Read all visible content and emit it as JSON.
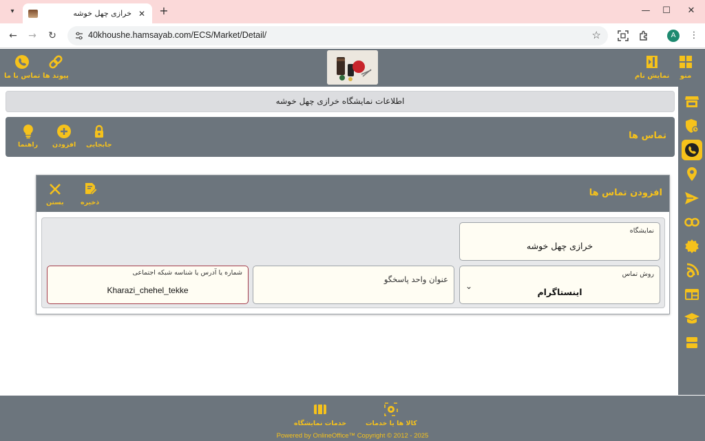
{
  "browser": {
    "tab_title": "خرازی چهل خوشه",
    "url": "40khoushe.hamsayab.com/ECS/Market/Detail/",
    "avatar_letter": "A"
  },
  "header": {
    "right_buttons": [
      {
        "label": "منو",
        "icon": "grid-icon"
      },
      {
        "label": "نمایش نام",
        "icon": "sidebar-toggle-icon"
      }
    ],
    "left_buttons": [
      {
        "label": "پیوند ها",
        "icon": "link-icon"
      },
      {
        "label": "تماس با ما",
        "icon": "phone-icon"
      }
    ]
  },
  "info_bar": {
    "text": "اطلاعات نمایشگاه خرازی چهل خوشه"
  },
  "contacts": {
    "title": "تماس ها",
    "actions": [
      {
        "label": "جابجایی",
        "icon": "lock-icon"
      },
      {
        "label": "افزودن",
        "icon": "add-circle-icon"
      },
      {
        "label": "راهنما",
        "icon": "lightbulb-icon"
      }
    ]
  },
  "dialog": {
    "title": "افزودن تماس ها",
    "save_label": "ذخیره",
    "close_label": "بستن",
    "fields": {
      "exhibition": {
        "label": "نمایشگاه",
        "value": "خرازی چهل خوشه"
      },
      "contact_method": {
        "label": "روش تماس",
        "value": "اینستاگرام"
      },
      "responder_unit": {
        "label": "عنوان واحد پاسخگو",
        "value": ""
      },
      "address": {
        "label": "شماره یا آدرس یا شناسه شبکه اجتماعی",
        "value": "Kharazi_chehel_tekke"
      }
    }
  },
  "sidebar": {
    "items": [
      "store-icon",
      "shield-icon",
      "phone-icon",
      "location-icon",
      "send-icon",
      "link-icon",
      "badge-icon",
      "rss-icon",
      "layout-icon",
      "graduation-icon",
      "table-icon"
    ],
    "active_index": 2
  },
  "footer": {
    "buttons": [
      {
        "label": "کالا ها یا خدمات",
        "icon": "products-icon"
      },
      {
        "label": "خدمات نمایشگاه",
        "icon": "services-icon"
      }
    ],
    "powered": "Powered by OnlineOffice™ Copyright © 2012 - 2025"
  },
  "colors": {
    "accent": "#f6c21b",
    "bar": "#6c757d",
    "error_border": "#a33b4a"
  }
}
